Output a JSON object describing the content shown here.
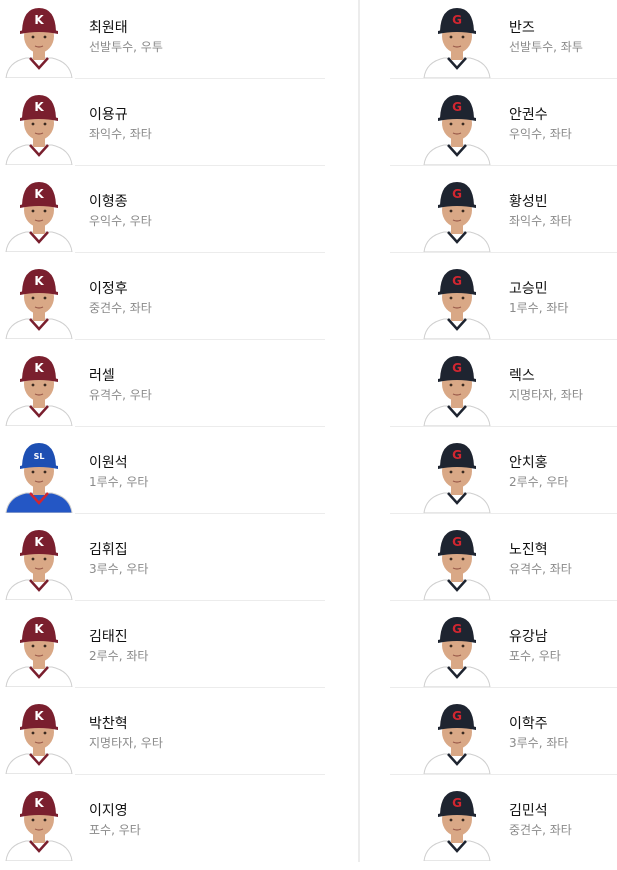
{
  "home_team": {
    "players": [
      {
        "name": "최원태",
        "info": "선발투수, 우투",
        "cap": "kiwoom-cap-icon"
      },
      {
        "name": "이용규",
        "info": "좌익수, 좌타",
        "cap": "kiwoom-cap-icon"
      },
      {
        "name": "이형종",
        "info": "우익수, 우타",
        "cap": "kiwoom-cap-icon"
      },
      {
        "name": "이정후",
        "info": "중견수, 좌타",
        "cap": "kiwoom-cap-icon"
      },
      {
        "name": "러셀",
        "info": "유격수, 우타",
        "cap": "kiwoom-cap-icon"
      },
      {
        "name": "이원석",
        "info": "1루수, 우타",
        "cap": "blue-cap-icon"
      },
      {
        "name": "김휘집",
        "info": "3루수, 우타",
        "cap": "kiwoom-cap-icon"
      },
      {
        "name": "김태진",
        "info": "2루수, 좌타",
        "cap": "kiwoom-cap-icon"
      },
      {
        "name": "박찬혁",
        "info": "지명타자, 우타",
        "cap": "kiwoom-cap-icon"
      },
      {
        "name": "이지영",
        "info": "포수, 우타",
        "cap": "kiwoom-cap-icon"
      }
    ]
  },
  "away_team": {
    "players": [
      {
        "name": "반즈",
        "info": "선발투수, 좌투",
        "cap": "giants-cap-icon"
      },
      {
        "name": "안권수",
        "info": "우익수, 좌타",
        "cap": "giants-cap-icon"
      },
      {
        "name": "황성빈",
        "info": "좌익수, 좌타",
        "cap": "giants-cap-icon"
      },
      {
        "name": "고승민",
        "info": "1루수, 좌타",
        "cap": "giants-cap-icon"
      },
      {
        "name": "렉스",
        "info": "지명타자, 좌타",
        "cap": "giants-cap-icon"
      },
      {
        "name": "안치홍",
        "info": "2루수, 우타",
        "cap": "giants-cap-icon"
      },
      {
        "name": "노진혁",
        "info": "유격수, 좌타",
        "cap": "giants-cap-icon"
      },
      {
        "name": "유강남",
        "info": "포수, 우타",
        "cap": "giants-cap-icon"
      },
      {
        "name": "이학주",
        "info": "3루수, 좌타",
        "cap": "giants-cap-icon"
      },
      {
        "name": "김민석",
        "info": "중견수, 좌타",
        "cap": "giants-cap-icon"
      }
    ]
  },
  "colors": {
    "kiwoom_cap": "#7a1f2e",
    "kiwoom_jersey": "#ffffff",
    "blue_cap": "#1d4fb3",
    "blue_jersey": "#2457c5",
    "giants_cap": "#1e2430",
    "giants_jersey": "#ffffff",
    "giants_logo": "#d22630",
    "skin": "#d9a886"
  }
}
